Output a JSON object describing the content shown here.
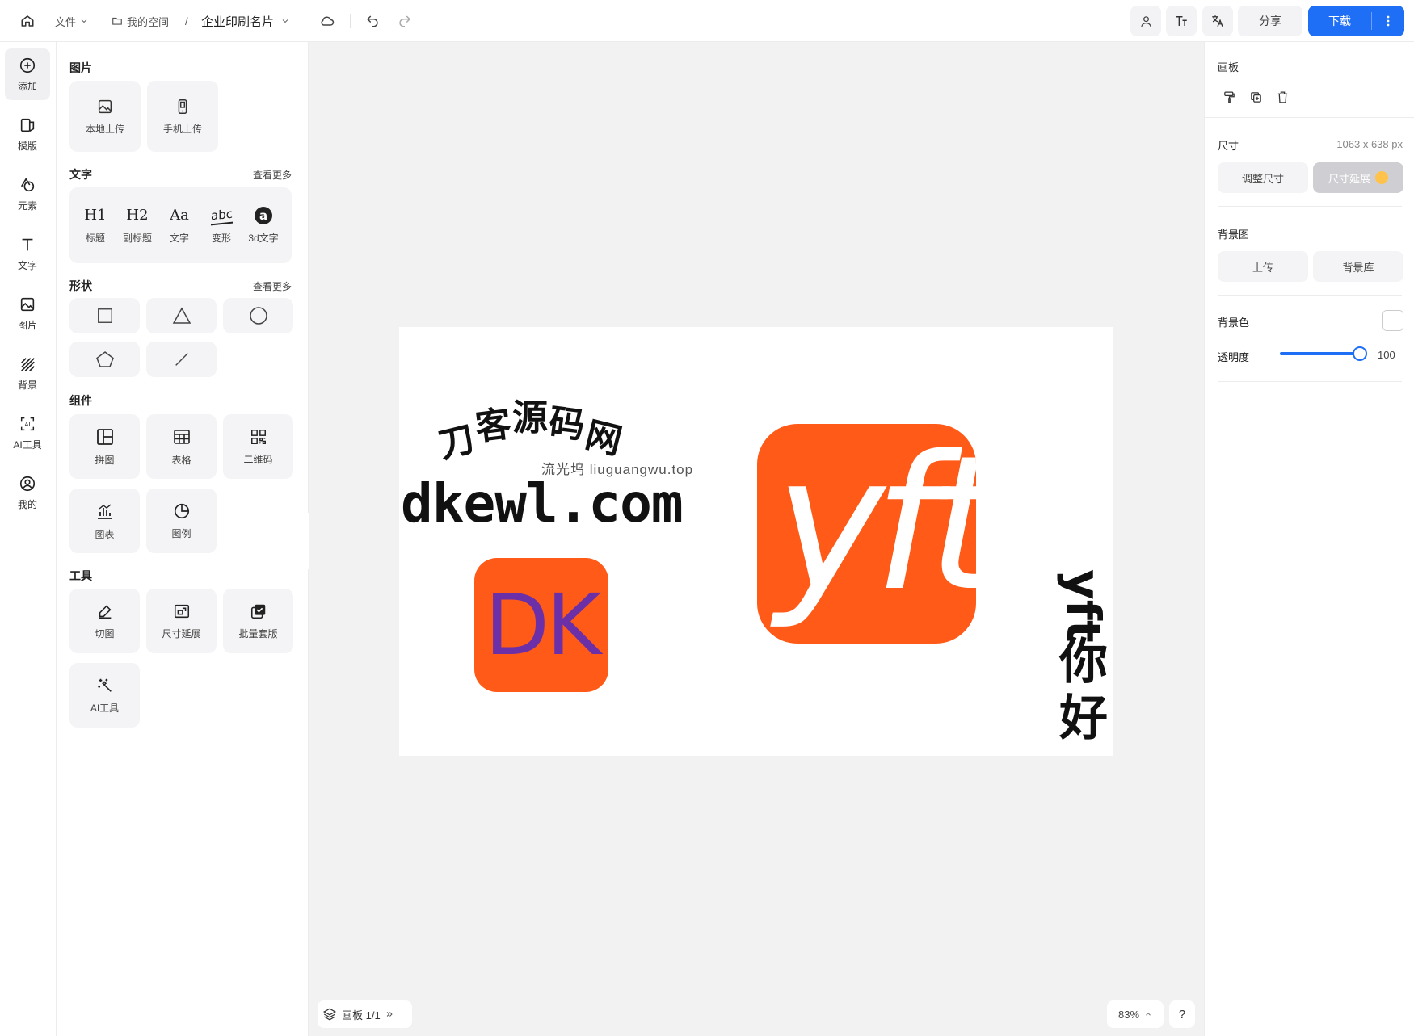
{
  "topbar": {
    "file_menu": "文件",
    "breadcrumb_space": "我的空间",
    "breadcrumb_sep": "/",
    "doc_title": "企业印刷名片",
    "share_label": "分享",
    "download_label": "下载"
  },
  "rail": [
    {
      "label": "添加",
      "icon": "add-icon"
    },
    {
      "label": "模版",
      "icon": "template-icon"
    },
    {
      "label": "元素",
      "icon": "elements-icon"
    },
    {
      "label": "文字",
      "icon": "text-icon"
    },
    {
      "label": "图片",
      "icon": "image-icon"
    },
    {
      "label": "背景",
      "icon": "background-icon"
    },
    {
      "label": "AI工具",
      "icon": "ai-tool-icon"
    },
    {
      "label": "我的",
      "icon": "my-icon"
    }
  ],
  "panel": {
    "images": {
      "title": "图片",
      "items": [
        {
          "label": "本地上传",
          "icon": "image-upload-icon"
        },
        {
          "label": "手机上传",
          "icon": "phone-icon"
        }
      ]
    },
    "text": {
      "title": "文字",
      "more": "查看更多",
      "items": [
        {
          "glyph": "H1",
          "label": "标题"
        },
        {
          "glyph": "H2",
          "label": "副标题"
        },
        {
          "glyph": "Aa",
          "label": "文字"
        },
        {
          "glyph": "abc",
          "label": "变形"
        },
        {
          "glyph": "a",
          "label": "3d文字"
        }
      ]
    },
    "shapes": {
      "title": "形状",
      "more": "查看更多",
      "items": [
        "square-shape-icon",
        "triangle-shape-icon",
        "circle-shape-icon",
        "pentagon-shape-icon",
        "line-shape-icon"
      ]
    },
    "components": {
      "title": "组件",
      "items": [
        {
          "label": "拼图",
          "icon": "collage-icon"
        },
        {
          "label": "表格",
          "icon": "table-icon"
        },
        {
          "label": "二维码",
          "icon": "qrcode-icon"
        },
        {
          "label": "图表",
          "icon": "chart-icon"
        },
        {
          "label": "图例",
          "icon": "pie-icon"
        }
      ]
    },
    "tools": {
      "title": "工具",
      "items": [
        {
          "label": "切图",
          "icon": "pen-icon"
        },
        {
          "label": "尺寸延展",
          "icon": "resize-icon"
        },
        {
          "label": "批量套版",
          "icon": "batch-icon"
        },
        {
          "label": "AI工具",
          "icon": "magic-wand-icon"
        }
      ]
    }
  },
  "artboard": {
    "headline_chars": [
      "刀",
      "客",
      "源",
      "码",
      "网"
    ],
    "subline": "流光坞 liuguangwu.top",
    "domain": "dkewl.com",
    "dk_logo": "DK",
    "yft_logo": "yft",
    "vertical_lines": [
      "yft",
      "你",
      "好"
    ],
    "colors": {
      "brand_orange": "#ff5a17",
      "dk_purple": "#6b2fa8"
    }
  },
  "bottom": {
    "layers_label": "画板 1/1",
    "zoom": "83%",
    "help": "?"
  },
  "rpanel": {
    "board_title": "画板",
    "size_title": "尺寸",
    "size_value": "1063 x 638 px",
    "resize_btn": "调整尺寸",
    "extend_btn": "尺寸延展",
    "bg_image_title": "背景图",
    "upload_btn": "上传",
    "bg_library_btn": "背景库",
    "bg_color_title": "背景色",
    "opacity_title": "透明度",
    "opacity_value": "100",
    "opacity_fraction": 1.0
  },
  "accent_color": "#1e6ff5"
}
